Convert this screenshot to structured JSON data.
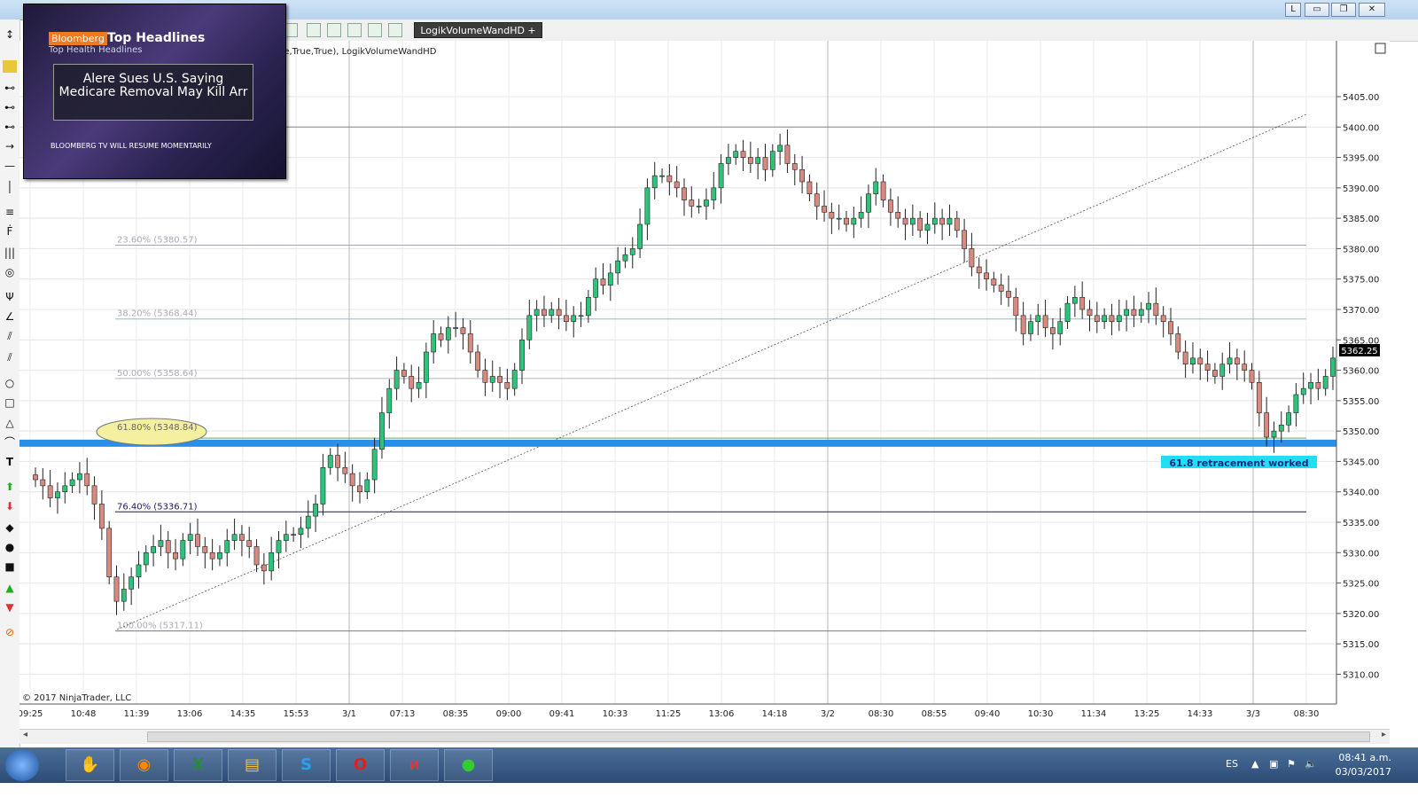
{
  "window": {
    "title_buttons": [
      "L",
      "▭",
      "❐",
      "✕"
    ]
  },
  "toolbar": {
    "indicator_button": "LogikVolumeWandHD +",
    "indicator_caption": "ue,True,True), LogikVolumeWandHD",
    "icons": [
      "chart-icon",
      "bar-chart-icon",
      "candles-icon",
      "line-icon",
      "dollar-icon",
      "properties-icon"
    ]
  },
  "news": {
    "brand": "Bloomberg",
    "top": "Top Headlines",
    "sub": "Top Health Headlines",
    "headline": "Alere Sues U.S. Saying Medicare Removal May Kill Arr",
    "resume": "BLOOMBERG TV WILL RESUME MOMENTARILY"
  },
  "chart_data": {
    "type": "candlestick",
    "price_axis": [
      "5405.00",
      "5400.00",
      "5395.00",
      "5390.00",
      "5385.00",
      "5380.00",
      "5375.00",
      "5370.00",
      "5365.00",
      "5360.00",
      "5355.00",
      "5350.00",
      "5345.00",
      "5340.00",
      "5335.00",
      "5330.00",
      "5325.00",
      "5320.00",
      "5315.00",
      "5310.00"
    ],
    "ylim": [
      5307,
      5412
    ],
    "time_axis": [
      "09:25",
      "10:48",
      "11:39",
      "13:06",
      "14:35",
      "15:53",
      "3/1",
      "07:13",
      "08:35",
      "09:00",
      "09:41",
      "10:33",
      "11:25",
      "13:06",
      "14:18",
      "3/2",
      "08:30",
      "08:55",
      "09:40",
      "10:30",
      "11:34",
      "13:25",
      "14:33",
      "3/3",
      "08:30"
    ],
    "last_price": "5362.25",
    "fib_levels": [
      {
        "label": "23.60% (5380.57)",
        "price": 5380.57
      },
      {
        "label": "38.20% (5368.44)",
        "price": 5368.44
      },
      {
        "label": "50.00% (5358.64)",
        "price": 5358.64
      },
      {
        "label": "61.80% (5348.84)",
        "price": 5348.84
      },
      {
        "label": "76.40% (5336.71)",
        "price": 5336.71
      },
      {
        "label": "100.00% (5317.11)",
        "price": 5317.11
      }
    ],
    "high_line": 5400.0,
    "support_band": 5348.0,
    "annotation": "61.8 retracement worked",
    "closes": [
      5342,
      5341,
      5339,
      5340,
      5341,
      5342,
      5343,
      5341,
      5338,
      5334,
      5326,
      5322,
      5324,
      5326,
      5328,
      5330,
      5331,
      5332,
      5330,
      5329,
      5332,
      5333,
      5331,
      5330,
      5329,
      5330,
      5332,
      5333,
      5332,
      5331,
      5328,
      5327,
      5330,
      5332,
      5333,
      5333,
      5334,
      5336,
      5338,
      5344,
      5346,
      5344,
      5343,
      5341,
      5340,
      5342,
      5347,
      5353,
      5357,
      5360,
      5359,
      5357,
      5358,
      5363,
      5366,
      5365,
      5367,
      5367,
      5366,
      5363,
      5360,
      5358,
      5359,
      5358,
      5357,
      5360,
      5365,
      5369,
      5370,
      5369,
      5370,
      5369,
      5368,
      5369,
      5369,
      5372,
      5375,
      5374,
      5376,
      5378,
      5379,
      5380,
      5384,
      5390,
      5392,
      5392,
      5391,
      5390,
      5388,
      5387,
      5387,
      5388,
      5390,
      5394,
      5395,
      5396,
      5395,
      5394,
      5395,
      5393,
      5396,
      5397,
      5394,
      5393,
      5391,
      5389,
      5387,
      5386,
      5385,
      5385,
      5384,
      5385,
      5386,
      5389,
      5391,
      5388,
      5386,
      5385,
      5384,
      5385,
      5383,
      5384,
      5385,
      5384,
      5385,
      5383,
      5380,
      5377,
      5376,
      5375,
      5374,
      5373,
      5372,
      5369,
      5366,
      5368,
      5369,
      5367,
      5366,
      5368,
      5371,
      5372,
      5370,
      5369,
      5368,
      5369,
      5368,
      5369,
      5370,
      5369,
      5370,
      5371,
      5369,
      5368,
      5366,
      5363,
      5361,
      5362,
      5361,
      5360,
      5359,
      5361,
      5362,
      5361,
      5360,
      5358,
      5353,
      5349,
      5350,
      5351,
      5353,
      5356,
      5357,
      5358,
      5357,
      5359,
      5362
    ]
  },
  "branding": {
    "copyright": "© 2017 NinjaTrader, LLC"
  },
  "taskbar": {
    "lang": "ES",
    "time": "08:41 a.m.",
    "date": "03/03/2017"
  }
}
